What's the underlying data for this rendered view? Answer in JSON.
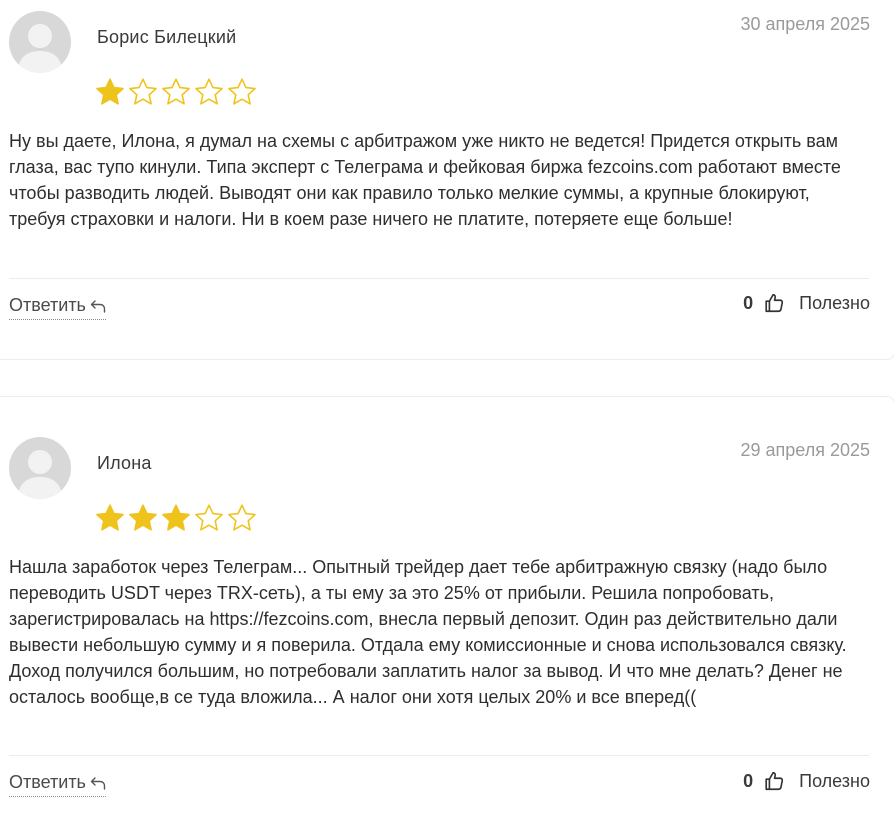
{
  "colors": {
    "star_filled": "#eec41c",
    "star_empty_stroke": "#eec41c",
    "avatar_bg": "#d8d8d8",
    "avatar_fg": "#f2f2f2",
    "date_text": "#9a9a9a"
  },
  "reviews": [
    {
      "author": "Борис Билецкий",
      "date": "30 апреля 2025",
      "rating": 1,
      "max_rating": 5,
      "text": "Ну вы даете, Илона, я думал на схемы с арбитражом уже никто не ведется! Придется открыть вам глаза, вас тупо кинули. Типа эксперт с Телеграма и фейковая биржа fezcoins.com работают вместе чтобы разводить людей. Выводят они как правило только мелкие суммы, а крупные блокируют, требуя страховки и налоги. Ни в коем разе ничего не платите, потеряете еще больше!",
      "reply_label": "Ответить",
      "helpful_count": "0",
      "helpful_label": "Полезно"
    },
    {
      "author": "Илона",
      "date": "29 апреля 2025",
      "rating": 3,
      "max_rating": 5,
      "text": "Нашла заработок через Телеграм... Опытный трейдер дает тебе арбитражную связку (надо было переводить USDT через TRX-сеть), а ты ему за это 25% от прибыли. Решила попробовать, зарегистрировалась на https://fezcoins.com, внесла первый депозит. Один раз действительно дали вывести небольшую сумму и я поверила. Отдала ему комиссионные и снова использовался связку. Доход получился большим, но потребовали заплатить налог за вывод. И что мне делать? Денег не осталось вообще,в се туда вложила... А налог они хотя целых 20% и все вперед((",
      "reply_label": "Ответить",
      "helpful_count": "0",
      "helpful_label": "Полезно"
    }
  ],
  "icons": {
    "avatar": "user-avatar-icon",
    "star": "star-icon",
    "reply": "reply-arrow-icon",
    "thumb": "thumbs-up-icon"
  }
}
